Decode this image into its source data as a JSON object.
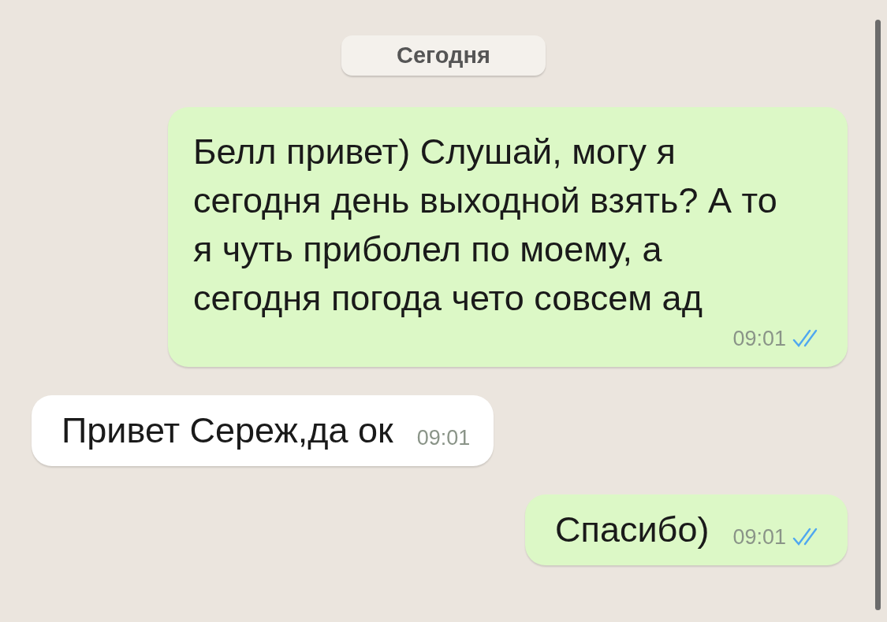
{
  "date_separator": "Сегодня",
  "messages": [
    {
      "kind": "outgoing",
      "text": "Белл привет) Слушай, могу я сегодня день выходной взять? А то я чуть приболел по моему, а сегодня погода чето совсем ад",
      "time": "09:01",
      "read": true
    },
    {
      "kind": "incoming",
      "text": "Привет Сереж,да ок",
      "time": "09:01"
    },
    {
      "kind": "outgoing",
      "text": "Спасибо)",
      "time": "09:01",
      "read": true
    }
  ]
}
